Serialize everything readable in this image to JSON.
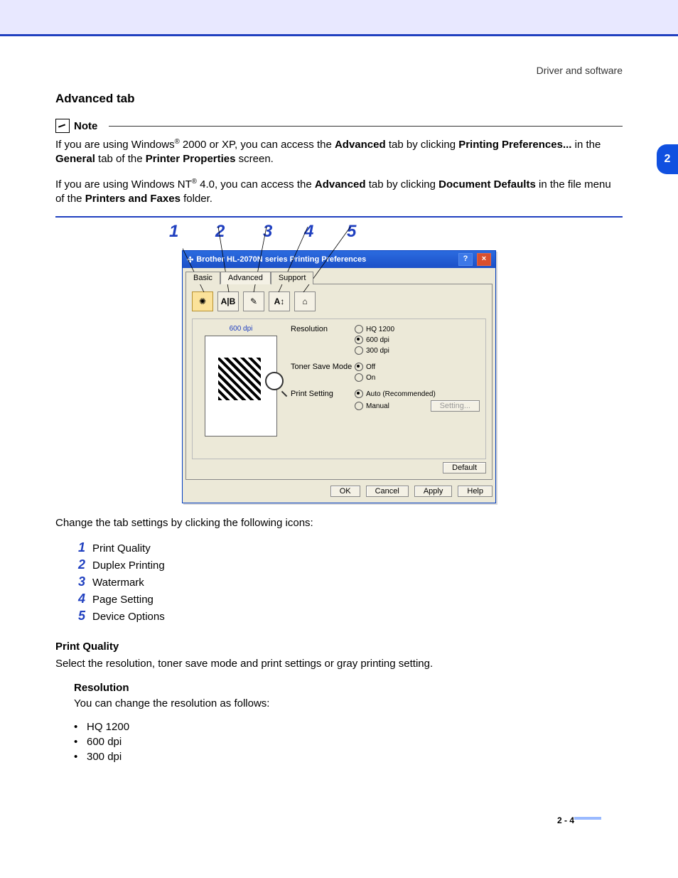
{
  "header": {
    "breadcrumb": "Driver and software"
  },
  "chapter_tab": "2",
  "section_title": "Advanced tab",
  "note": {
    "label": "Note",
    "p1_a": "If you are using Windows",
    "p1_sup": "®",
    "p1_b": " 2000 or XP, you can access the ",
    "p1_bold1": "Advanced",
    "p1_c": " tab by clicking ",
    "p1_bold2": "Printing Preferences...",
    "p1_d": " in the ",
    "p1_bold3": "General",
    "p1_e": " tab of the ",
    "p1_bold4": "Printer Properties",
    "p1_f": " screen.",
    "p2_a": "If you are using Windows NT",
    "p2_sup": "®",
    "p2_b": " 4.0, you can access the ",
    "p2_bold1": "Advanced",
    "p2_c": " tab by clicking ",
    "p2_bold2": "Document Defaults",
    "p2_d": " in the file menu of the ",
    "p2_bold3": "Printers and Faxes",
    "p2_e": " folder."
  },
  "callouts": [
    "1",
    "2",
    "3",
    "4",
    "5"
  ],
  "window": {
    "title": "Brother HL-2070N series Printing Preferences",
    "tabs": {
      "basic": "Basic",
      "advanced": "Advanced",
      "support": "Support"
    },
    "preview_label": "600 dpi",
    "labels": {
      "resolution": "Resolution",
      "toner": "Toner Save Mode",
      "print_setting": "Print Setting"
    },
    "resolution_opts": [
      "HQ 1200",
      "600 dpi",
      "300 dpi"
    ],
    "resolution_selected": 1,
    "toner_opts": [
      "Off",
      "On"
    ],
    "toner_selected": 0,
    "ps_opts": [
      "Auto (Recommended)",
      "Manual"
    ],
    "ps_selected": 0,
    "setting_btn": "Setting...",
    "default_btn": "Default",
    "buttons": {
      "ok": "OK",
      "cancel": "Cancel",
      "apply": "Apply",
      "help": "Help"
    },
    "icons": [
      "print-quality-icon",
      "duplex-icon",
      "watermark-icon",
      "page-setting-icon",
      "device-options-icon"
    ]
  },
  "after": {
    "intro": "Change the tab settings by clicking the following icons:",
    "items": [
      "Print Quality",
      "Duplex Printing",
      "Watermark",
      "Page Setting",
      "Device Options"
    ]
  },
  "pq": {
    "title": "Print Quality",
    "desc": "Select the resolution, toner save mode and print settings or gray printing setting.",
    "res_title": "Resolution",
    "res_desc": "You can change the resolution as follows:",
    "res_items": [
      "HQ 1200",
      "600 dpi",
      "300 dpi"
    ]
  },
  "footer": {
    "pagenum": "2 - 4"
  }
}
